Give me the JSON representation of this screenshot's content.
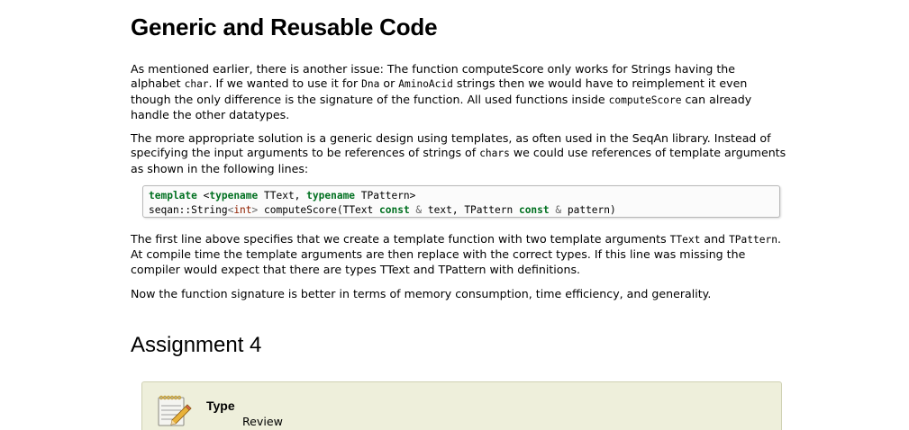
{
  "section": {
    "title": "Generic and Reusable Code"
  },
  "para1": {
    "t1": "As mentioned earlier, there is another issue: The function computeScore only works for Strings having the alphabet ",
    "c1": "char",
    "t2": ". If we wanted to use it for ",
    "c2": "Dna",
    "t3": " or ",
    "c3": "AminoAcid",
    "t4": " strings then we would have to reimplement it even though the only difference is the signature of the function. All used functions inside ",
    "c4": "computeScore",
    "t5": " can already handle the other datatypes."
  },
  "para2": {
    "t1": "The more appropriate solution is a generic design using templates, as often used in the SeqAn library. Instead of specifying the input arguments to be references of strings of ",
    "c1": "chars",
    "t2": " we could use references of template arguments as shown in the following lines:"
  },
  "code": {
    "line1": {
      "kw_template": "template",
      "lt": " <",
      "kw_typename1": "typename",
      "ttext": " TText, ",
      "kw_typename2": "typename",
      "tpattern": " TPattern>"
    },
    "line2": {
      "ns": "seqan::String",
      "lt": "<",
      "int": "int",
      "gt": ">",
      "fn": " computeScore(TText ",
      "kw_const1": "const",
      "amp1": " & ",
      "arg1": "text, TPattern ",
      "kw_const2": "const",
      "amp2": " & ",
      "arg2": "pattern)"
    }
  },
  "para3": {
    "t1": "The first line above specifies that we create a template function with two template arguments ",
    "c1": "TText",
    "t2": " and ",
    "c2": "TPattern",
    "t3": ". At compile time the template arguments are then replace with the correct types. If this line was missing the compiler would expect that there are types TText and TPattern with definitions."
  },
  "para4": {
    "text": "Now the function signature is better in terms of memory consumption, time efficiency, and generality."
  },
  "assignment": {
    "title": "Assignment 4",
    "type_label": "Type",
    "type_value": "Review",
    "icon": "notepad-pencil-icon"
  },
  "colors": {
    "keyword": "#007020",
    "type": "#902000",
    "assignment_bg": "#eeefdb"
  }
}
